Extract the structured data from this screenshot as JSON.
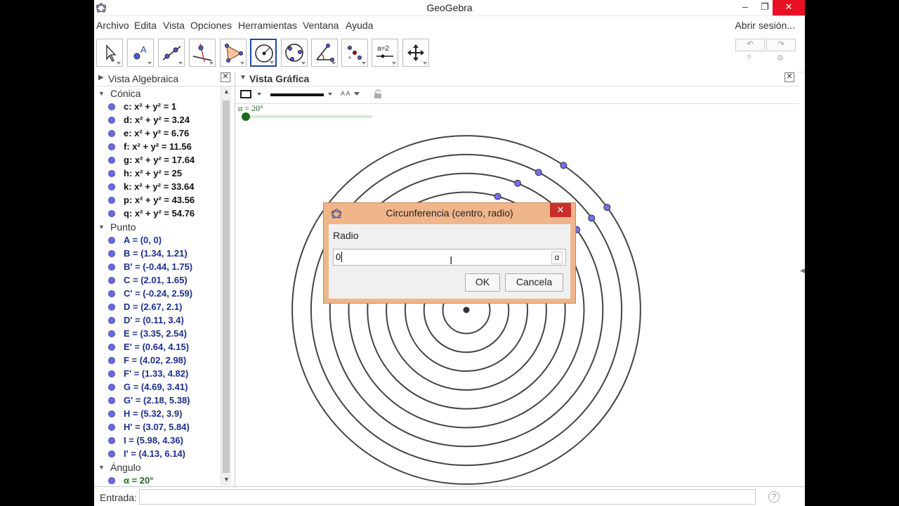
{
  "window": {
    "title": "GeoGebra",
    "minimize": "–",
    "restore": "❐",
    "close": "✕"
  },
  "menu": {
    "items": [
      "Archivo",
      "Edita",
      "Vista",
      "Opciones",
      "Herramientas",
      "Ventana",
      "Ayuda"
    ],
    "login": "Abrir sesión..."
  },
  "toolbar": {
    "tools": [
      "move-tool",
      "point-tool",
      "line-tool",
      "perpendicular-tool",
      "polygon-tool",
      "circle-center-radius-tool",
      "circle-three-points-tool",
      "angle-tool",
      "reflect-tool",
      "slider-tool",
      "move-view-tool"
    ],
    "selected": "circle-center-radius-tool",
    "slider_label": "a=2",
    "undo": "↶",
    "redo": "↷",
    "help": "?",
    "settings": "⚙"
  },
  "algebra": {
    "title": "Vista Algebraica",
    "close": "✕",
    "categories": [
      {
        "name": "Cónica",
        "items": [
          "c: x² + y² = 1",
          "d: x² + y² = 3.24",
          "e: x² + y² = 6.76",
          "f: x² + y² = 11.56",
          "g: x² + y² = 17.64",
          "h: x² + y² = 25",
          "k: x² + y² = 33.64",
          "p: x² + y² = 43.56",
          "q: x² + y² = 54.76"
        ]
      },
      {
        "name": "Punto",
        "items": [
          "A = (0, 0)",
          "B = (1.34, 1.21)",
          "B' = (-0.44, 1.75)",
          "C = (2.01, 1.65)",
          "C' = (-0.24, 2.59)",
          "D = (2.67, 2.1)",
          "D' = (0.11, 3.4)",
          "E = (3.35, 2.54)",
          "E' = (0.64, 4.15)",
          "F = (4.02, 2.98)",
          "F' = (1.33, 4.82)",
          "G = (4.69, 3.41)",
          "G' = (2.18, 5.38)",
          "H = (5.32, 3.9)",
          "H' = (3.07, 5.84)",
          "I = (5.98, 4.36)",
          "I' = (4.13, 6.14)"
        ]
      },
      {
        "name": "Ángulo",
        "items": [
          "α = 20°"
        ]
      }
    ]
  },
  "graphics": {
    "title": "Vista Gráfica",
    "close": "✕",
    "slider_label": "α = 20°",
    "slider_value_fraction": 0.0,
    "font_size_label": "A A",
    "colors": {
      "circle": "#444444",
      "point": "#7070e8",
      "center": "#333333",
      "slider": "#1c6a1c"
    }
  },
  "dialog": {
    "title": "Circunferencia (centro, radio)",
    "close": "✕",
    "field_label": "Radio",
    "value": "0",
    "alpha_button": "α",
    "ok": "OK",
    "cancel": "Cancela",
    "color": "#f0b58b"
  },
  "input": {
    "label": "Entrada:",
    "value": "",
    "help": "?"
  }
}
